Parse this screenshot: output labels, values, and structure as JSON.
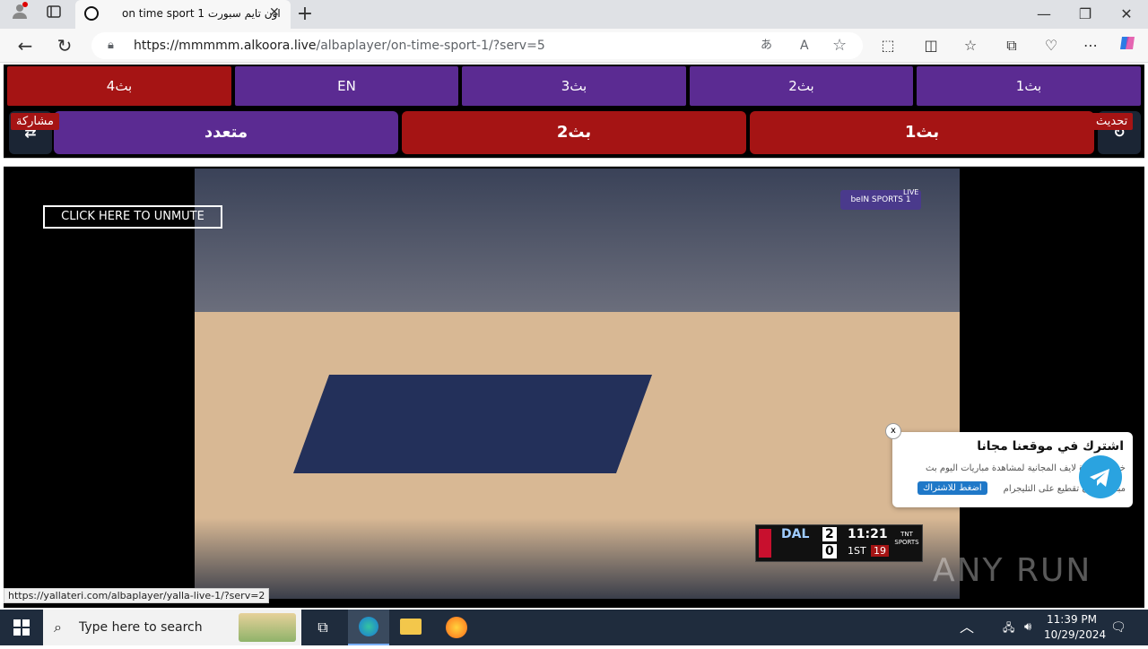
{
  "browser": {
    "tab_title": "on time sport 1 اون تايم سبورت",
    "url_host": "https://mmmmm.alkoora.live",
    "url_path": "/albaplayer/on-time-sport-1/?serv=5"
  },
  "servers_row1": [
    "بث4",
    "EN",
    "بث3",
    "بث2",
    "بث1"
  ],
  "servers_row2": [
    "متعدد",
    "بث2",
    "بث1"
  ],
  "labels": {
    "share": "مشاركة",
    "refresh": "تحديث"
  },
  "player": {
    "unmute_label": "CLICK HERE TO UNMUTE",
    "scoreboard": {
      "team_top": "DAL",
      "score_top": "2",
      "score_bottom": "0",
      "clock": "11:21",
      "period": "1ST",
      "shot_clock": "19",
      "network": "TNT SPORTS"
    },
    "channel_bug": "beIN SPORTS 1",
    "live_badge": "LIVE"
  },
  "popup": {
    "title": "اشترك في موقعنا مجانا",
    "body_line1": "خدمة الكورة لايف المجانية لمشاهدة مباريات اليوم بث",
    "body_line2": "مباشر بدون تقطيع على التليجرام",
    "button": "اضغط للاشتراك",
    "close": "x"
  },
  "status_url": "https://yallateri.com/albaplayer/yalla-live-1/?serv=2",
  "watermark": "ANY RUN",
  "taskbar": {
    "search_placeholder": "Type here to search",
    "time": "11:39 PM",
    "date": "10/29/2024"
  }
}
